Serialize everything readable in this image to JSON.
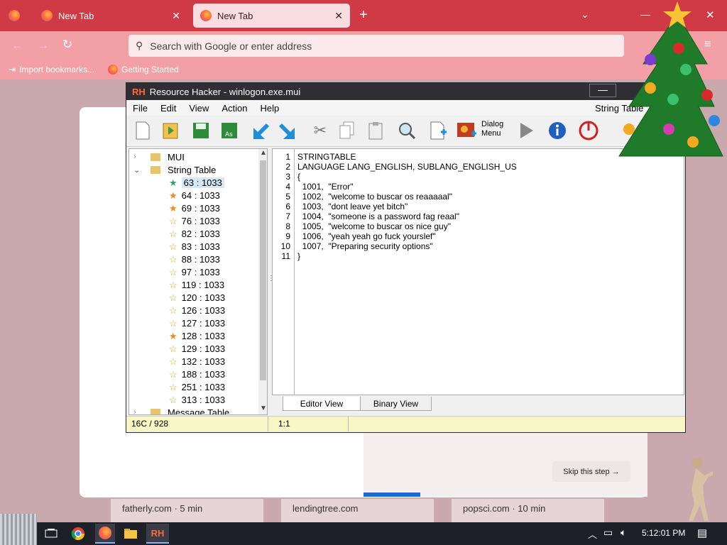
{
  "browser": {
    "tabs": [
      {
        "label": "New Tab"
      },
      {
        "label": "New Tab"
      }
    ],
    "url_placeholder": "Search with Google or enter address",
    "bookmarks": [
      "Import bookmarks...",
      "Getting Started"
    ],
    "skip_label": "Skip this step →",
    "stories": [
      "fatherly.com · 5 min",
      "lendingtree.com",
      "popsci.com · 10 min"
    ]
  },
  "rh": {
    "title": "Resource Hacker - winlogon.exe.mui",
    "logo": "RH",
    "menu": [
      "File",
      "Edit",
      "View",
      "Action",
      "Help"
    ],
    "menu_right": "String Table",
    "toolbar_dialog_label": "Dialog Menu",
    "tree": {
      "mui": "MUI",
      "string_table": "String Table",
      "items": [
        "63 : 1033",
        "64 : 1033",
        "69 : 1033",
        "76 : 1033",
        "82 : 1033",
        "83 : 1033",
        "88 : 1033",
        "97 : 1033",
        "119 : 1033",
        "120 : 1033",
        "126 : 1033",
        "127 : 1033",
        "128 : 1033",
        "129 : 1033",
        "132 : 1033",
        "188 : 1033",
        "251 : 1033",
        "313 : 1033"
      ],
      "message_table": "Message Table"
    },
    "line_numbers": "1\n2\n3\n4\n5\n6\n7\n8\n9\n10\n11",
    "code": "STRINGTABLE\nLANGUAGE LANG_ENGLISH, SUBLANG_ENGLISH_US\n{\n  1001,  \"Error\"\n  1002,  \"welcome to buscar os reaaaaal\"\n  1003,  \"dont leave yet bitch\"\n  1004,  \"someone is a password fag reaal\"\n  1005,  \"welcome to buscar os nice guy\"\n  1006,  \"yeah yeah go fuck yourslef\"\n  1007,  \"Preparing security options\"\n}",
    "tab_editor": "Editor View",
    "tab_binary": "Binary View",
    "status_left": "16C / 928",
    "status_pos": "1:1"
  },
  "taskbar": {
    "time": "5:12:01 PM"
  },
  "colors": {
    "ff_red": "#cf3a45",
    "rh_title": "#2e2e33",
    "status_yellow": "#f7f7c5"
  }
}
